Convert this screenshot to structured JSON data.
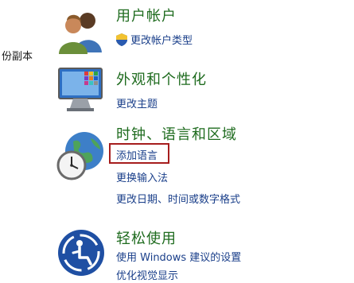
{
  "left_fragment": "份副本",
  "categories": [
    {
      "title": "用户帐户",
      "links": [
        {
          "label": "更改帐户类型",
          "shield": true
        }
      ],
      "icon": "users-icon"
    },
    {
      "title": "外观和个性化",
      "links": [
        {
          "label": "更改主题"
        }
      ],
      "icon": "monitor-palette-icon"
    },
    {
      "title": "时钟、语言和区域",
      "links": [
        {
          "label": "添加语言",
          "highlighted": true
        },
        {
          "label": "更换输入法"
        },
        {
          "label": "更改日期、时间或数字格式"
        }
      ],
      "icon": "globe-clock-icon"
    },
    {
      "title": "轻松使用",
      "links": [
        {
          "label": "使用 Windows 建议的设置"
        },
        {
          "label": "优化视觉显示"
        }
      ],
      "icon": "accessibility-icon"
    }
  ],
  "colors": {
    "category_title": "#1e6b1e",
    "link": "#1a3f8a",
    "highlight_border": "#a61d1d"
  }
}
